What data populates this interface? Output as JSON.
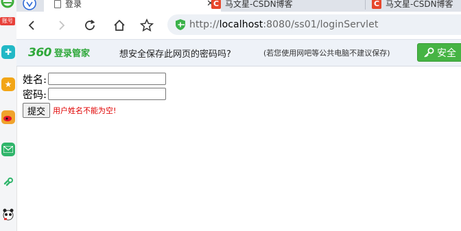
{
  "sidebar": {
    "account_badge": "账号",
    "icons": [
      "360-browser-icon",
      "app-icon",
      "favorites-star-icon",
      "weibo-icon",
      "mail-icon",
      "link-icon",
      "panda-icon"
    ]
  },
  "tabs": [
    {
      "title": "登录",
      "active": true
    },
    {
      "title": "马文星-CSDN博客",
      "active": false
    },
    {
      "title": "马文星-CSDN博客",
      "active": false
    }
  ],
  "nav": {
    "url_scheme": "http://",
    "url_host": "localhost",
    "url_rest": ":8080/ss01/loginServlet"
  },
  "infobar": {
    "brand_num": "360",
    "brand_name": "登录管家",
    "question": "想安全保存此网页的密码吗?",
    "note": "(若您使用网吧等公共电脑不建议保存)",
    "save_button": "安全"
  },
  "form": {
    "name_label": "姓名:",
    "password_label": "密码:",
    "submit_label": "提交",
    "error_message": "用户姓名不能为空!"
  },
  "colors": {
    "brand_green": "#2fa83a",
    "error_red": "#e00000",
    "csdn_red": "#e6472c"
  }
}
